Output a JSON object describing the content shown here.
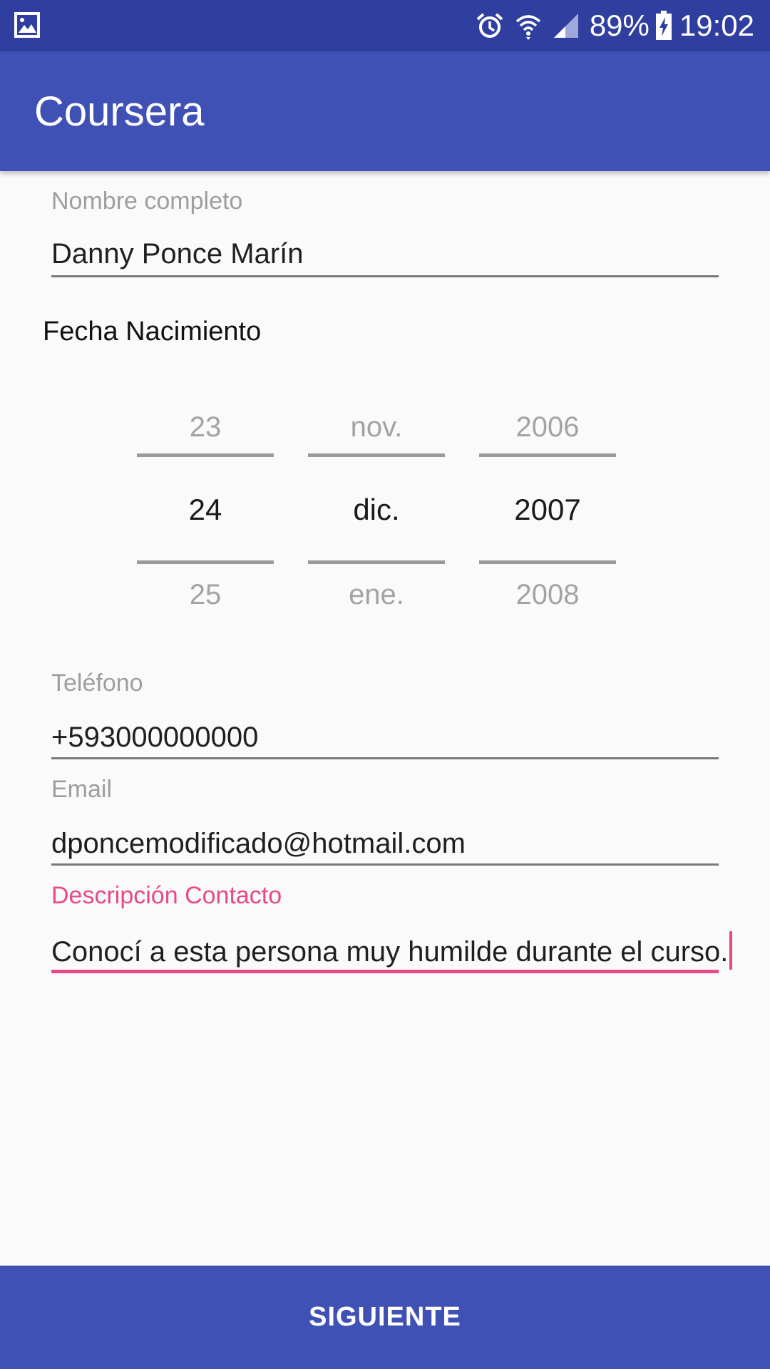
{
  "status_bar": {
    "battery_percent": "89%",
    "time": "19:02",
    "icons": [
      "gallery-icon",
      "alarm-icon",
      "wifi-icon",
      "signal-icon",
      "battery-charging-icon"
    ]
  },
  "toolbar": {
    "title": "Coursera"
  },
  "form": {
    "full_name": {
      "label": "Nombre completo",
      "value": "Danny Ponce Marín"
    },
    "birth_date": {
      "label": "Fecha Nacimiento",
      "day": {
        "prev": "23",
        "current": "24",
        "next": "25"
      },
      "month": {
        "prev": "nov.",
        "current": "dic.",
        "next": "ene."
      },
      "year": {
        "prev": "2006",
        "current": "2007",
        "next": "2008"
      }
    },
    "phone": {
      "label": "Teléfono",
      "value": "+593000000000"
    },
    "email": {
      "label": "Email",
      "value": "dponcemodificado@hotmail.com"
    },
    "description": {
      "label": "Descripción Contacto",
      "value": "Conocí a esta persona muy humilde durante el curso."
    }
  },
  "next_button": {
    "label": "SIGUIENTE"
  },
  "colors": {
    "primary_dark": "#303f9f",
    "primary": "#3f51b5",
    "accent": "#e84a86"
  }
}
